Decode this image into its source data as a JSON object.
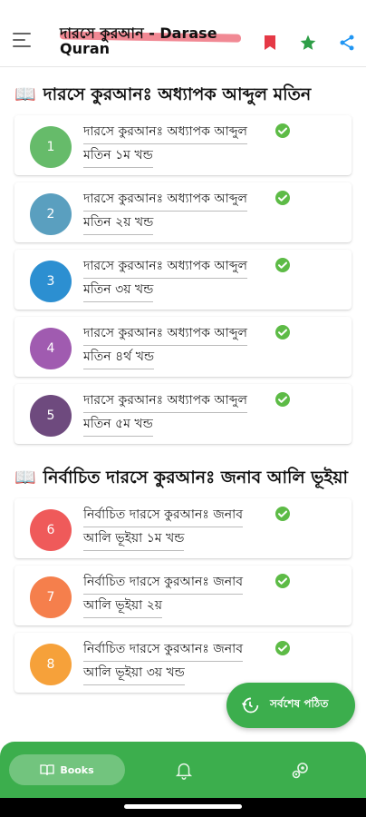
{
  "header": {
    "title": "দারসে কুরআন - Darase Quran"
  },
  "colors": {
    "primary": "#3cae4d",
    "bookmark": "#e53946",
    "star": "#2e9e47",
    "share": "#2196f3"
  },
  "sections": [
    {
      "title": "দারসে কুরআনঃ অধ্যাপক আব্দুল মতিন",
      "items": [
        {
          "num": "1",
          "line1": "দারসে কুরআনঃ অধ্যাপক আব্দুল",
          "line2": "মতিন ১ম খন্ড",
          "color": "#66bb6a"
        },
        {
          "num": "2",
          "line1": "দারসে কুরআনঃ অধ্যাপক আব্দুল",
          "line2": "মতিন ২য় খন্ড",
          "color": "#5a9fbf"
        },
        {
          "num": "3",
          "line1": "দারসে কুরআনঃ অধ্যাপক আব্দুল",
          "line2": "মতিন ৩য় খন্ড",
          "color": "#2c8fd1"
        },
        {
          "num": "4",
          "line1": "দারসে কুরআনঃ অধ্যাপক আব্দুল",
          "line2": "মতিন ৪র্থ খন্ড",
          "color": "#a05bb0"
        },
        {
          "num": "5",
          "line1": "দারসে কুরআনঃ অধ্যাপক আব্দুল",
          "line2": "মতিন ৫ম খন্ড",
          "color": "#6e4a7e"
        }
      ]
    },
    {
      "title": "নির্বাচিত দারসে কুরআনঃ জনাব আলি ভূইয়া",
      "items": [
        {
          "num": "6",
          "line1": "নির্বাচিত দারসে কুরআনঃ জনাব",
          "line2": "আলি ভূইয়া ১ম খন্ড",
          "color": "#ef5a5a"
        },
        {
          "num": "7",
          "line1": "নির্বাচিত দারসে কুরআনঃ জনাব",
          "line2": "আলি ভূইয়া ২য়",
          "color": "#f57f4c"
        },
        {
          "num": "8",
          "line1": "নির্বাচিত দারসে কুরআনঃ জনাব",
          "line2": "আলি ভূইয়া ৩য় খন্ড",
          "color": "#f6a13a"
        }
      ]
    }
  ],
  "fab": {
    "label": "সর্বশেষ পঠিত"
  },
  "nav": {
    "books_label": "Books"
  }
}
